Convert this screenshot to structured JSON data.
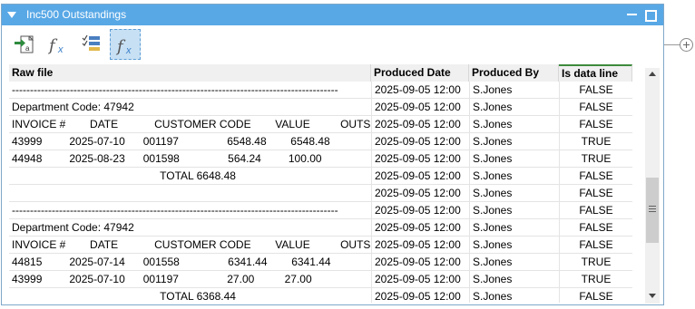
{
  "window": {
    "title": "Inc500 Outstandings",
    "accent_color": "#58a8e6"
  },
  "toolbar": {
    "buttons": [
      {
        "icon": "import-file-icon"
      },
      {
        "icon": "function-icon"
      },
      {
        "icon": "list-columns-icon"
      },
      {
        "icon": "function-selected-icon",
        "selected": true
      }
    ]
  },
  "table": {
    "columns": [
      "Raw file",
      "Produced Date",
      "Produced By",
      "Is data line"
    ],
    "rows": [
      [
        "------------------------------------------------------------------------------------------",
        "2025-09-05 12:00",
        "S.Jones",
        "FALSE"
      ],
      [
        "Department Code: 47942",
        "2025-09-05 12:00",
        "S.Jones",
        "FALSE"
      ],
      [
        "INVOICE #        DATE            CUSTOMER CODE        VALUE          OUTSTANDING",
        "2025-09-05 12:00",
        "S.Jones",
        "FALSE"
      ],
      [
        "43999         2025-07-10      001197                6548.48        6548.48",
        "2025-09-05 12:00",
        "S.Jones",
        "TRUE"
      ],
      [
        "44948         2025-08-23      001598                564.24         100.00",
        "2025-09-05 12:00",
        "S.Jones",
        "TRUE"
      ],
      [
        "                                                 TOTAL 6648.48",
        "2025-09-05 12:00",
        "S.Jones",
        "FALSE"
      ],
      [
        "",
        "2025-09-05 12:00",
        "S.Jones",
        "FALSE"
      ],
      [
        "------------------------------------------------------------------------------------------",
        "2025-09-05 12:00",
        "S.Jones",
        "FALSE"
      ],
      [
        "Department Code: 47942",
        "2025-09-05 12:00",
        "S.Jones",
        "FALSE"
      ],
      [
        "INVOICE #        DATE            CUSTOMER CODE        VALUE          OUTSTANDING",
        "2025-09-05 12:00",
        "S.Jones",
        "FALSE"
      ],
      [
        "44815         2025-07-14      001558                6341.44        6341.44",
        "2025-09-05 12:00",
        "S.Jones",
        "TRUE"
      ],
      [
        "43999         2025-07-10      001197                27.00          27.00",
        "2025-09-05 12:00",
        "S.Jones",
        "TRUE"
      ],
      [
        "                                                 TOTAL 6368.44",
        "2025-09-05 12:00",
        "S.Jones",
        "FALSE"
      ]
    ]
  }
}
